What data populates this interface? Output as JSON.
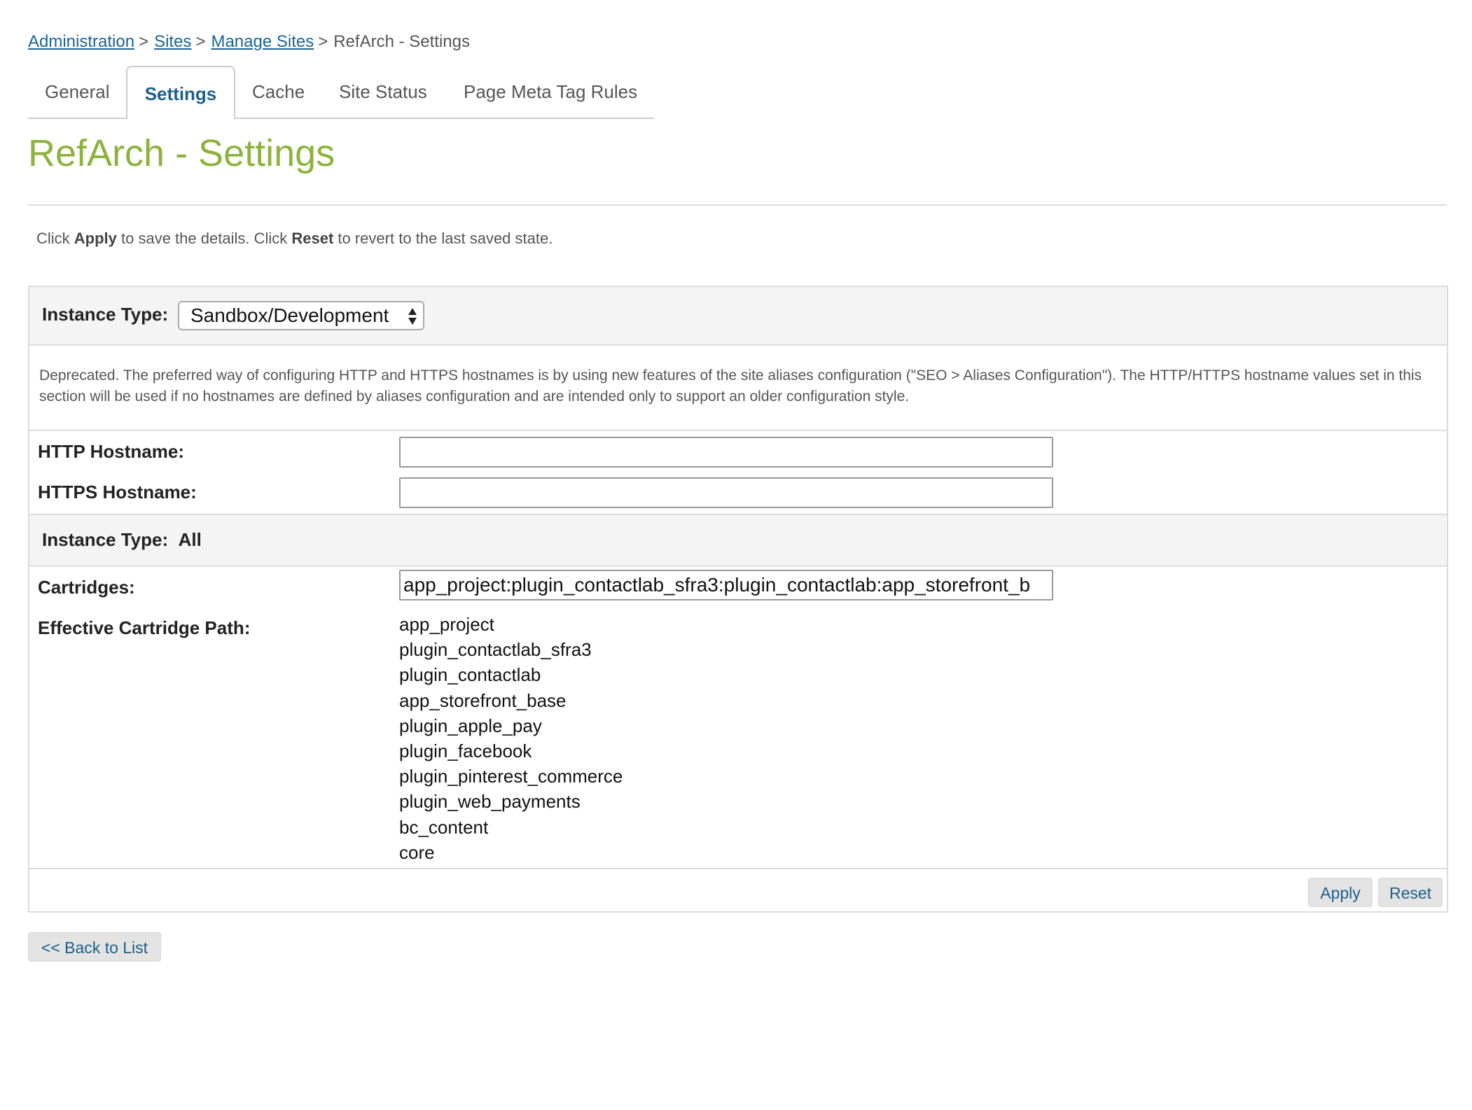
{
  "breadcrumb": {
    "items": [
      "Administration",
      "Sites",
      "Manage Sites"
    ],
    "separator": ">",
    "current": "RefArch - Settings"
  },
  "tabs": [
    {
      "label": "General",
      "active": false
    },
    {
      "label": "Settings",
      "active": true
    },
    {
      "label": "Cache",
      "active": false
    },
    {
      "label": "Site Status",
      "active": false
    },
    {
      "label": "Page Meta Tag Rules",
      "active": false
    }
  ],
  "page": {
    "title": "RefArch - Settings",
    "title_color": "#8cb33d",
    "instructions": {
      "part1": "Click ",
      "apply_word": "Apply",
      "part2": " to save the details. Click ",
      "reset_word": "Reset",
      "part3": " to revert to the last saved state."
    }
  },
  "form": {
    "instance_type_label": "Instance Type:",
    "instance_type_value": "Sandbox/Development",
    "deprecated_note": "Deprecated. The preferred way of configuring HTTP and HTTPS hostnames is by using new features of the site aliases configuration (\"SEO > Aliases Configuration\"). The HTTP/HTTPS hostname values set in this section will be used if no hostnames are defined by aliases configuration and are intended only to support an older configuration style.",
    "http_hostname_label": "HTTP Hostname:",
    "http_hostname_value": "",
    "https_hostname_label": "HTTPS Hostname:",
    "https_hostname_value": "",
    "instance_type_all_label": "Instance Type:",
    "instance_type_all_value": "All",
    "cartridges_label": "Cartridges:",
    "cartridges_value": "app_project:plugin_contactlab_sfra3:plugin_contactlab:app_storefront_b",
    "effective_path_label": "Effective Cartridge Path:",
    "effective_path": [
      "app_project",
      "plugin_contactlab_sfra3",
      "plugin_contactlab",
      "app_storefront_base",
      "plugin_apple_pay",
      "plugin_facebook",
      "plugin_pinterest_commerce",
      "plugin_web_payments",
      "bc_content",
      "core"
    ],
    "apply_label": "Apply",
    "reset_label": "Reset"
  },
  "back_label": "<< Back to List",
  "colors": {
    "link": "#1a6496",
    "active_tab": "#1f5f8b",
    "button_bg": "#e3e3e3"
  }
}
